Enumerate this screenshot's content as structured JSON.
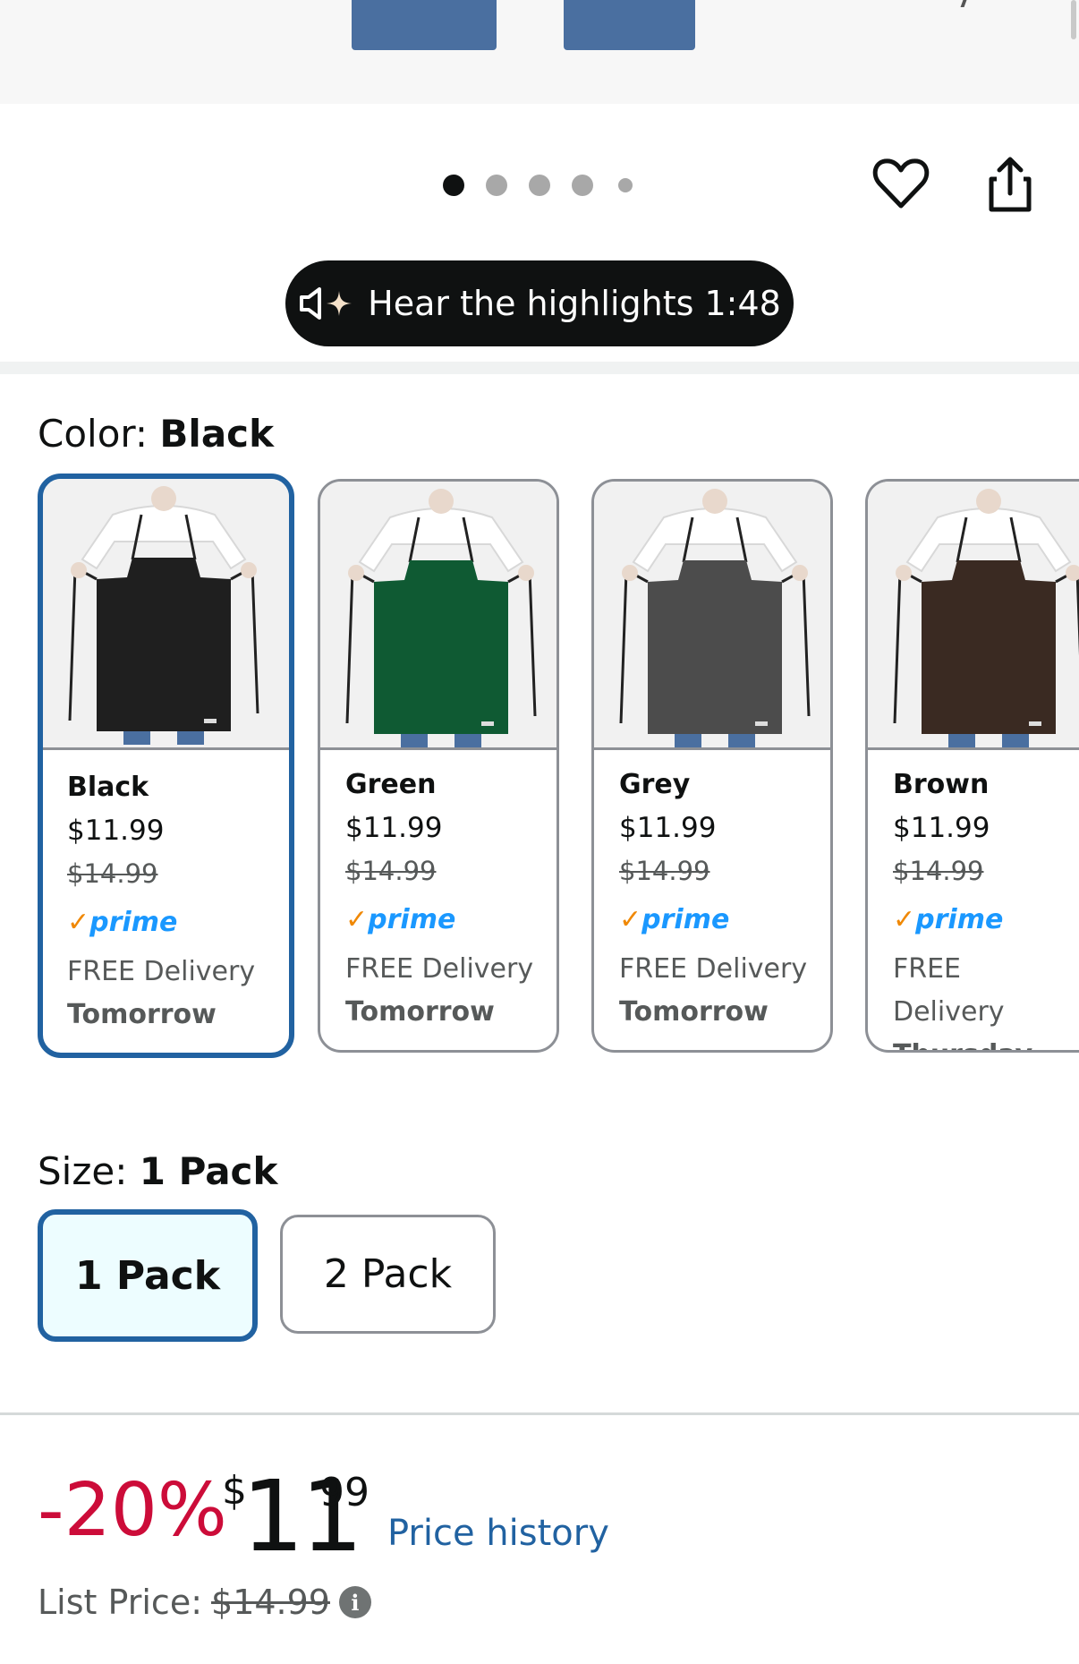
{
  "gallery": {
    "dot_count": 5,
    "active_index": 0,
    "highlights_label": "Hear the highlights 1:48",
    "icons": [
      "heart-icon",
      "share-icon",
      "speaker-sparkle-icon"
    ]
  },
  "color": {
    "label": "Color: ",
    "selected": "Black",
    "options": [
      {
        "name": "Black",
        "price": "$11.99",
        "old_price": "$14.99",
        "prime": "prime",
        "delivery": "FREE Delivery",
        "day": "Tomorrow",
        "swatch": "#1f1f1f"
      },
      {
        "name": "Green",
        "price": "$11.99",
        "old_price": "$14.99",
        "prime": "prime",
        "delivery": "FREE Delivery",
        "day": "Tomorrow",
        "swatch": "#0f5a33"
      },
      {
        "name": "Grey",
        "price": "$11.99",
        "old_price": "$14.99",
        "prime": "prime",
        "delivery": "FREE Delivery",
        "day": "Tomorrow",
        "swatch": "#4c4c4c"
      },
      {
        "name": "Brown",
        "price": "$11.99",
        "old_price": "$14.99",
        "prime": "prime",
        "delivery": "FREE Delivery",
        "day": "Thursday",
        "swatch": "#3a2a22"
      }
    ]
  },
  "size": {
    "label": "Size: ",
    "selected": "1 Pack",
    "options": [
      "1 Pack",
      "2 Pack"
    ]
  },
  "price": {
    "discount": "-20%",
    "symbol": "$",
    "whole": "11",
    "fraction": "99",
    "history_link": "Price history",
    "list_label": "List Price:",
    "list_value": "$14.99"
  },
  "colors": {
    "selected_border": "#2162a1",
    "discount_red": "#cc0c39",
    "link_blue": "#2162a1",
    "prime_blue": "#1a98ff",
    "prime_check": "#f08804"
  }
}
